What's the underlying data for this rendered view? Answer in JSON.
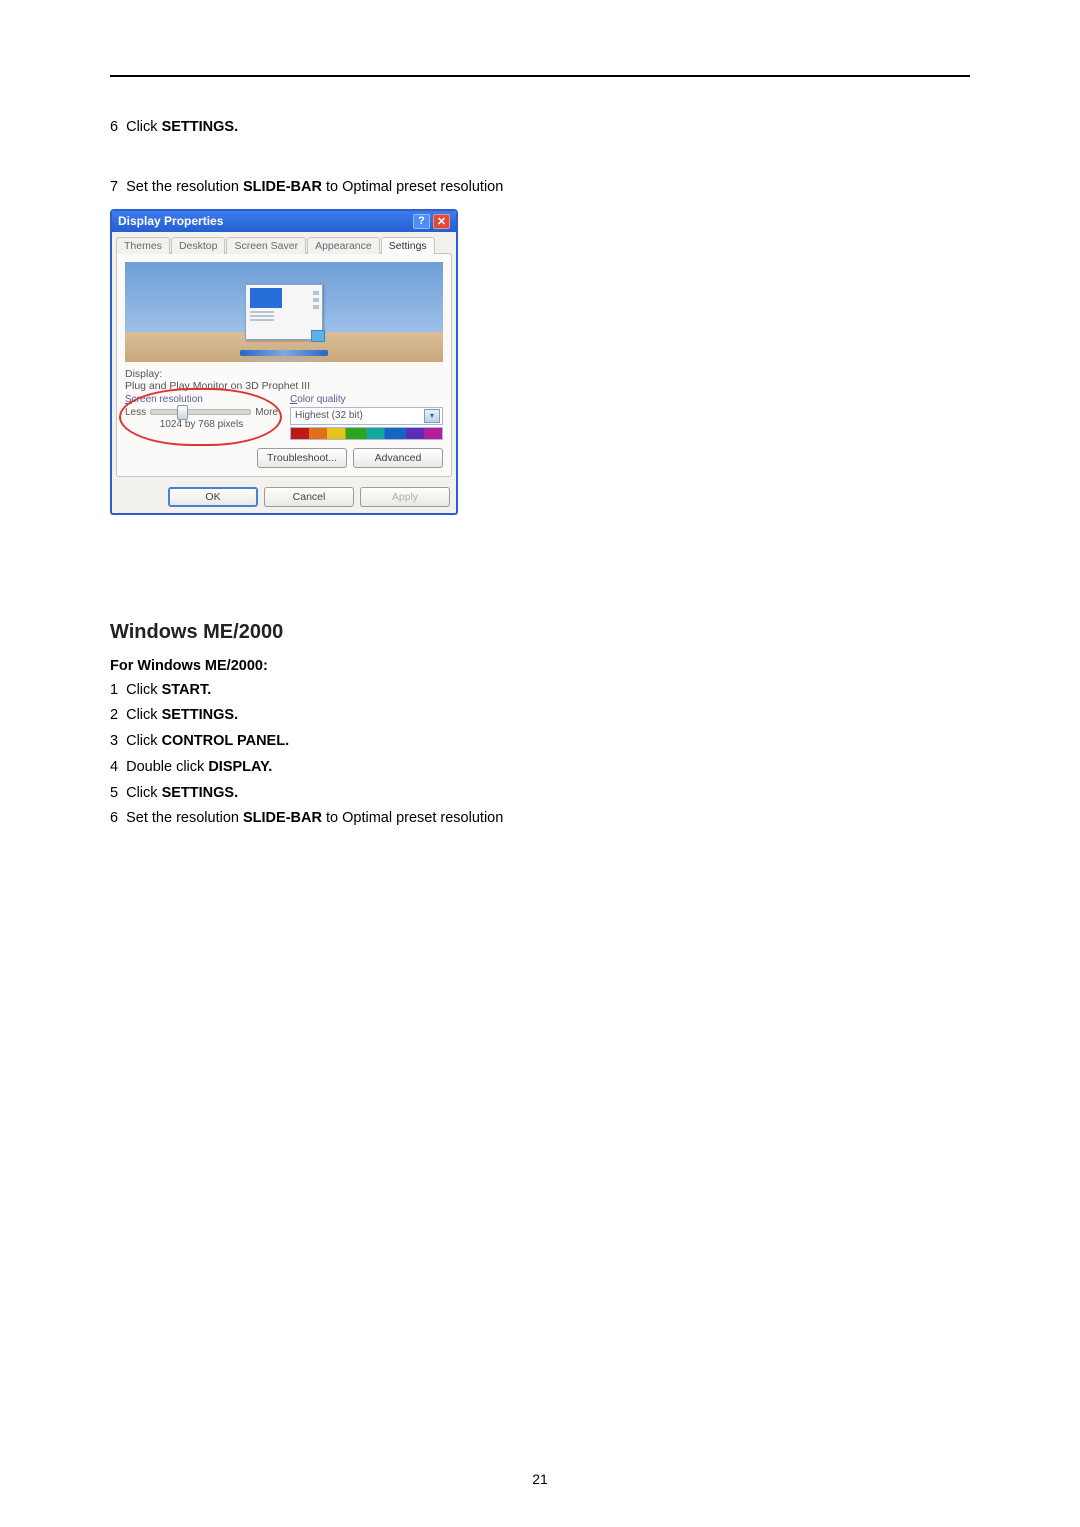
{
  "step6": {
    "num": "6",
    "prefix": "Click ",
    "bold": "SETTINGS."
  },
  "step7": {
    "num": "7",
    "prefix": "Set the resolution ",
    "bold": "SLIDE-BAR",
    "suffix": " to Optimal preset resolution"
  },
  "dialog": {
    "title": "Display Properties",
    "help": "?",
    "close": "✕",
    "tabs": [
      "Themes",
      "Desktop",
      "Screen Saver",
      "Appearance",
      "Settings"
    ],
    "display_label": "Display:",
    "display_value": "Plug and Play Monitor on 3D Prophet III",
    "res_label": "Screen resolution",
    "less": "Less",
    "more": "More",
    "res_value": "1024 by 768 pixels",
    "color_label": "Color quality",
    "color_value": "Highest (32 bit)",
    "btn_troubleshoot": "Troubleshoot...",
    "btn_advanced": "Advanced",
    "btn_ok": "OK",
    "btn_cancel": "Cancel",
    "btn_apply": "Apply"
  },
  "section_heading": "Windows ME/2000",
  "section_sub": "For Windows ME/2000:",
  "me_steps": [
    {
      "num": "1",
      "prefix": "Click ",
      "bold": "START."
    },
    {
      "num": "2",
      "prefix": "Click ",
      "bold": "SETTINGS."
    },
    {
      "num": "3",
      "prefix": "Click ",
      "bold": "CONTROL PANEL."
    },
    {
      "num": "4",
      "prefix": "Double click ",
      "bold": "DISPLAY."
    },
    {
      "num": "5",
      "prefix": "Click ",
      "bold": "SETTINGS."
    },
    {
      "num": "6",
      "prefix": "Set the resolution ",
      "bold": "SLIDE-BAR",
      "suffix": " to Optimal preset resolution"
    }
  ],
  "page_number": "21"
}
